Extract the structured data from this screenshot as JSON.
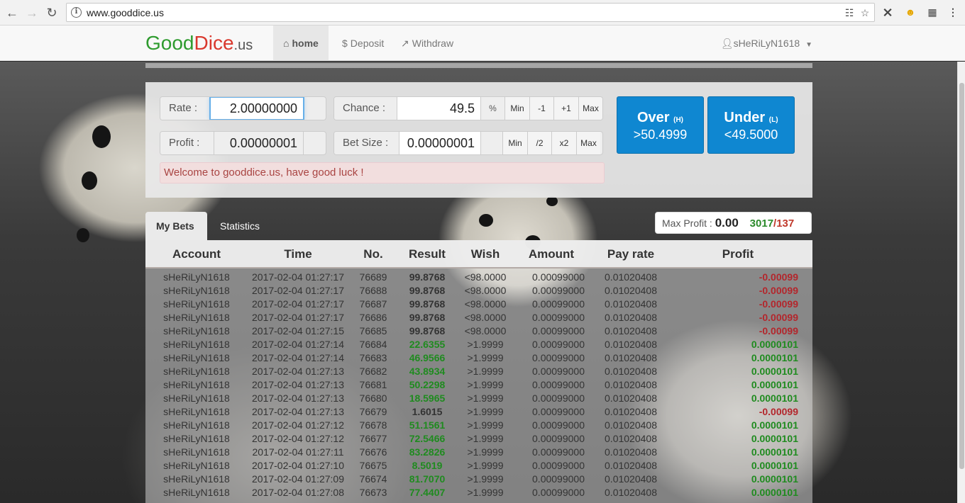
{
  "browser": {
    "url": "www.gooddice.us"
  },
  "brand": {
    "part1": "Good",
    "part2": "Dice",
    "tld": ".us"
  },
  "nav": {
    "home": "home",
    "deposit": "Deposit",
    "withdraw": "Withdraw",
    "user": "sHeRiLyN1618"
  },
  "controls": {
    "rate_label": "Rate :",
    "rate_value": "2.00000000",
    "chance_label": "Chance :",
    "chance_value": "49.5",
    "chance_unit": "%",
    "chance_buttons": [
      "Min",
      "-1",
      "+1",
      "Max"
    ],
    "profit_label": "Profit :",
    "profit_value": "0.00000001",
    "betsize_label": "Bet Size :",
    "betsize_value": "0.00000001",
    "betsize_buttons": [
      "Min",
      "/2",
      "x2",
      "Max"
    ],
    "over_label": "Over",
    "over_key": "(H)",
    "over_value": ">50.4999",
    "under_label": "Under",
    "under_key": "(L)",
    "under_value": "<49.5000",
    "welcome": "Welcome to gooddice.us, have good luck !"
  },
  "tabs": {
    "my_bets": "My Bets",
    "statistics": "Statistics"
  },
  "max_profit": {
    "label": "Max Profit :",
    "value": "0.00",
    "wins": "3017",
    "separator": "/",
    "losses": "137"
  },
  "table": {
    "headers": [
      "Account",
      "Time",
      "No.",
      "Result",
      "Wish",
      "Amount",
      "Pay rate",
      "Profit"
    ],
    "rows": [
      {
        "account": "sHeRiLyN1618",
        "time": "2017-02-04 01:27:17",
        "no": "76689",
        "result": "99.8768",
        "result_state": "neutral",
        "wish": "<98.0000",
        "amount": "0.00099000",
        "payrate": "0.01020408",
        "profit": "-0.00099",
        "profit_state": "lose"
      },
      {
        "account": "sHeRiLyN1618",
        "time": "2017-02-04 01:27:17",
        "no": "76688",
        "result": "99.8768",
        "result_state": "neutral",
        "wish": "<98.0000",
        "amount": "0.00099000",
        "payrate": "0.01020408",
        "profit": "-0.00099",
        "profit_state": "lose"
      },
      {
        "account": "sHeRiLyN1618",
        "time": "2017-02-04 01:27:17",
        "no": "76687",
        "result": "99.8768",
        "result_state": "neutral",
        "wish": "<98.0000",
        "amount": "0.00099000",
        "payrate": "0.01020408",
        "profit": "-0.00099",
        "profit_state": "lose"
      },
      {
        "account": "sHeRiLyN1618",
        "time": "2017-02-04 01:27:17",
        "no": "76686",
        "result": "99.8768",
        "result_state": "neutral",
        "wish": "<98.0000",
        "amount": "0.00099000",
        "payrate": "0.01020408",
        "profit": "-0.00099",
        "profit_state": "lose"
      },
      {
        "account": "sHeRiLyN1618",
        "time": "2017-02-04 01:27:15",
        "no": "76685",
        "result": "99.8768",
        "result_state": "neutral",
        "wish": "<98.0000",
        "amount": "0.00099000",
        "payrate": "0.01020408",
        "profit": "-0.00099",
        "profit_state": "lose"
      },
      {
        "account": "sHeRiLyN1618",
        "time": "2017-02-04 01:27:14",
        "no": "76684",
        "result": "22.6355",
        "result_state": "win",
        "wish": ">1.9999",
        "amount": "0.00099000",
        "payrate": "0.01020408",
        "profit": "0.0000101",
        "profit_state": "win"
      },
      {
        "account": "sHeRiLyN1618",
        "time": "2017-02-04 01:27:14",
        "no": "76683",
        "result": "46.9566",
        "result_state": "win",
        "wish": ">1.9999",
        "amount": "0.00099000",
        "payrate": "0.01020408",
        "profit": "0.0000101",
        "profit_state": "win"
      },
      {
        "account": "sHeRiLyN1618",
        "time": "2017-02-04 01:27:13",
        "no": "76682",
        "result": "43.8934",
        "result_state": "win",
        "wish": ">1.9999",
        "amount": "0.00099000",
        "payrate": "0.01020408",
        "profit": "0.0000101",
        "profit_state": "win"
      },
      {
        "account": "sHeRiLyN1618",
        "time": "2017-02-04 01:27:13",
        "no": "76681",
        "result": "50.2298",
        "result_state": "win",
        "wish": ">1.9999",
        "amount": "0.00099000",
        "payrate": "0.01020408",
        "profit": "0.0000101",
        "profit_state": "win"
      },
      {
        "account": "sHeRiLyN1618",
        "time": "2017-02-04 01:27:13",
        "no": "76680",
        "result": "18.5965",
        "result_state": "win",
        "wish": ">1.9999",
        "amount": "0.00099000",
        "payrate": "0.01020408",
        "profit": "0.0000101",
        "profit_state": "win"
      },
      {
        "account": "sHeRiLyN1618",
        "time": "2017-02-04 01:27:13",
        "no": "76679",
        "result": "1.6015",
        "result_state": "neutral",
        "wish": ">1.9999",
        "amount": "0.00099000",
        "payrate": "0.01020408",
        "profit": "-0.00099",
        "profit_state": "lose"
      },
      {
        "account": "sHeRiLyN1618",
        "time": "2017-02-04 01:27:12",
        "no": "76678",
        "result": "51.1561",
        "result_state": "win",
        "wish": ">1.9999",
        "amount": "0.00099000",
        "payrate": "0.01020408",
        "profit": "0.0000101",
        "profit_state": "win"
      },
      {
        "account": "sHeRiLyN1618",
        "time": "2017-02-04 01:27:12",
        "no": "76677",
        "result": "72.5466",
        "result_state": "win",
        "wish": ">1.9999",
        "amount": "0.00099000",
        "payrate": "0.01020408",
        "profit": "0.0000101",
        "profit_state": "win"
      },
      {
        "account": "sHeRiLyN1618",
        "time": "2017-02-04 01:27:11",
        "no": "76676",
        "result": "83.2826",
        "result_state": "win",
        "wish": ">1.9999",
        "amount": "0.00099000",
        "payrate": "0.01020408",
        "profit": "0.0000101",
        "profit_state": "win"
      },
      {
        "account": "sHeRiLyN1618",
        "time": "2017-02-04 01:27:10",
        "no": "76675",
        "result": "8.5019",
        "result_state": "win",
        "wish": ">1.9999",
        "amount": "0.00099000",
        "payrate": "0.01020408",
        "profit": "0.0000101",
        "profit_state": "win"
      },
      {
        "account": "sHeRiLyN1618",
        "time": "2017-02-04 01:27:09",
        "no": "76674",
        "result": "81.7070",
        "result_state": "win",
        "wish": ">1.9999",
        "amount": "0.00099000",
        "payrate": "0.01020408",
        "profit": "0.0000101",
        "profit_state": "win"
      },
      {
        "account": "sHeRiLyN1618",
        "time": "2017-02-04 01:27:08",
        "no": "76673",
        "result": "77.4407",
        "result_state": "win",
        "wish": ">1.9999",
        "amount": "0.00099000",
        "payrate": "0.01020408",
        "profit": "0.0000101",
        "profit_state": "win"
      }
    ]
  },
  "colors": {
    "brand_green": "#2e9b2e",
    "brand_red": "#d9382d",
    "primary_button": "#0f87d1",
    "win": "#1f8b1f",
    "lose": "#b3262c",
    "alert_bg": "#f2dede"
  }
}
